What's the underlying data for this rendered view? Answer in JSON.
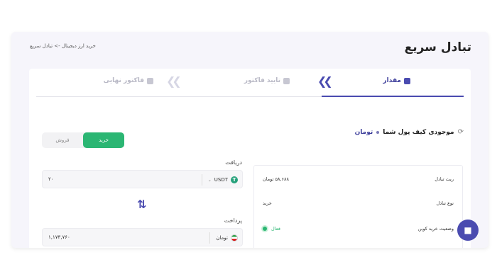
{
  "header": {
    "title": "تبادل سریع",
    "breadcrumb": "خرید ارز دیجیتال -> تبادل سریع"
  },
  "steps": [
    {
      "label": "مقدار",
      "icon": "calculator-icon",
      "state": "active"
    },
    {
      "label": "تایید فاکتور",
      "icon": "checklist-icon",
      "state": "inactive"
    },
    {
      "label": "فاکتور نهایی",
      "icon": "document-icon",
      "state": "inactive"
    }
  ],
  "wallet": {
    "label": "موجودی کیف پول شما",
    "unit": "تومان",
    "icon": "refresh-icon"
  },
  "trade_toggle": {
    "buy": "خرید",
    "sell": "فروش",
    "selected": "buy"
  },
  "receive": {
    "label": "دریافت",
    "currency": "USDT",
    "amount": "۲۰"
  },
  "pay": {
    "label": "پرداخت",
    "currency": "تومان",
    "amount": "۱,۱۷۳,۷۶۰"
  },
  "info": {
    "rate_label": "ریت تبادل",
    "rate_value": "۵۸,۶۸۸ تومان",
    "type_label": "نوع تبادل",
    "type_value": "خرید",
    "status_label": "وضعیت خرید کوین",
    "status_value": "فعال"
  },
  "colors": {
    "accent": "#4a4bb0",
    "buy_green": "#2bb673",
    "background": "#f6f5fb"
  }
}
